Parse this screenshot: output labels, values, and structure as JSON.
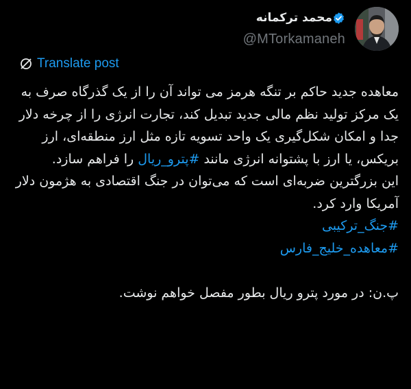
{
  "author": {
    "display_name": "محمد ترکمانه",
    "handle": "@MTorkamaneh",
    "verified": true,
    "badge_color": "#1d9bf0"
  },
  "actions": {
    "more_icon": "more-horizontal-icon",
    "translate_label": "Translate post",
    "translate_icon": "translate-icon"
  },
  "colors": {
    "background": "#000000",
    "text": "#e7e9ea",
    "secondary": "#71767b",
    "link": "#1d9bf0"
  },
  "post": {
    "para1_before": "معاهده جدید حاکم بر تنگه هرمز می تواند آن را از یک گذرگاه صرف به یک مرکز تولید نظم مالی جدید تبدیل کند، تجارت انرژی را از چرخه دلار جدا و امکان شکل‌گیری یک واحد تسویه تازه مثل ارز منطقه‌ای، ارز بریکس، یا ارز با پشتوانه انرژی مانند ",
    "para1_hashtag": "#پترو_ریال",
    "para1_after": " را فراهم سازد.",
    "para2": "این بزرگترین ضربه‌ای است که می‌توان در جنگ اقتصادی به هژمون دلار آمریکا وارد کرد.",
    "hashtag1": "#جنگ_ترکیبی",
    "hashtag2": "#معاهده_خلیج_فارس",
    "ps": "پ.ن: در مورد پترو ریال بطور مفصل خواهم نوشت."
  }
}
